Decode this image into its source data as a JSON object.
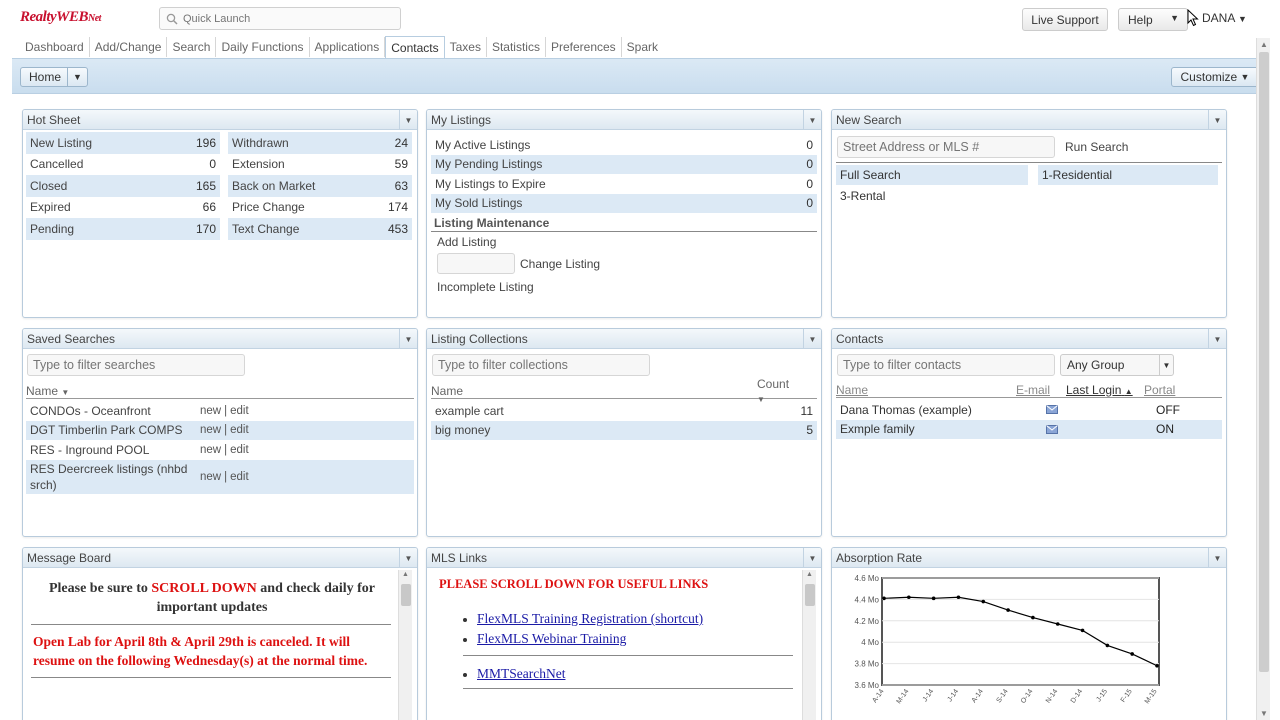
{
  "app": {
    "logo_main": "RealtyWEB",
    "logo_net": "Net",
    "quick_launch_placeholder": "Quick Launch",
    "live_support": "Live Support",
    "help": "Help",
    "user": "DANA"
  },
  "tabs": [
    "Dashboard",
    "Add/Change",
    "Search",
    "Daily Functions",
    "Applications",
    "Contacts",
    "Taxes",
    "Statistics",
    "Preferences",
    "Spark"
  ],
  "active_tab": "Contacts",
  "band": {
    "home": "Home",
    "customize": "Customize"
  },
  "hot_sheet": {
    "title": "Hot Sheet",
    "left": [
      {
        "label": "New Listing",
        "count": "196"
      },
      {
        "label": "Cancelled",
        "count": "0"
      },
      {
        "label": "Closed",
        "count": "165"
      },
      {
        "label": "Expired",
        "count": "66"
      },
      {
        "label": "Pending",
        "count": "170"
      }
    ],
    "right": [
      {
        "label": "Withdrawn",
        "count": "24"
      },
      {
        "label": "Extension",
        "count": "59"
      },
      {
        "label": "Back on Market",
        "count": "63"
      },
      {
        "label": "Price Change",
        "count": "174"
      },
      {
        "label": "Text Change",
        "count": "453"
      }
    ]
  },
  "my_listings": {
    "title": "My Listings",
    "items": [
      {
        "label": "My Active Listings",
        "count": "0"
      },
      {
        "label": "My Pending Listings",
        "count": "0"
      },
      {
        "label": "My Listings to Expire",
        "count": "0"
      },
      {
        "label": "My Sold Listings",
        "count": "0"
      }
    ],
    "maintenance_title": "Listing Maintenance",
    "add_listing": "Add Listing",
    "change_listing": "Change Listing",
    "incomplete_listing": "Incomplete Listing"
  },
  "new_search": {
    "title": "New Search",
    "placeholder": "Street Address or MLS #",
    "run": "Run Search",
    "options": [
      "Full Search",
      "3-Rental",
      "1-Residential"
    ]
  },
  "saved_searches": {
    "title": "Saved Searches",
    "placeholder": "Type to filter searches",
    "col_name": "Name",
    "rows": [
      {
        "name": "CONDOs - Oceanfront",
        "new": "new",
        "sep": "|",
        "edit": "edit"
      },
      {
        "name": "DGT Timberlin Park COMPS",
        "new": "new",
        "sep": "|",
        "edit": "edit"
      },
      {
        "name": "RES - Inground POOL",
        "new": "new",
        "sep": "|",
        "edit": "edit"
      },
      {
        "name": "RES Deercreek listings (nhbd srch)",
        "new": "new",
        "sep": "|",
        "edit": "edit"
      }
    ]
  },
  "collections": {
    "title": "Listing Collections",
    "placeholder": "Type to filter collections",
    "col_name": "Name",
    "col_count": "Count",
    "rows": [
      {
        "name": "example cart",
        "count": "11"
      },
      {
        "name": "big money",
        "count": "5"
      }
    ]
  },
  "contacts": {
    "title": "Contacts",
    "placeholder": "Type to filter contacts",
    "group": "Any Group",
    "col_name": "Name",
    "col_email": "E-mail",
    "col_login": "Last Login",
    "col_portal": "Portal",
    "rows": [
      {
        "name": "Dana Thomas (example)",
        "portal": "OFF"
      },
      {
        "name": "Exmple family",
        "portal": "ON"
      }
    ]
  },
  "message_board": {
    "title": "Message Board",
    "p1_a": "Please be sure to",
    "p1_b": "SCROLL DOWN",
    "p1_c": "and check daily for important updates",
    "p2": "Open Lab for April 8th & April 29th is canceled.  It will resume on the following Wednesday(s) at the normal time."
  },
  "mls_links": {
    "title": "MLS Links",
    "header": "PLEASE SCROLL DOWN FOR USEFUL LINKS",
    "links": [
      "FlexMLS Training Registration (shortcut)",
      "FlexMLS Webinar Training"
    ],
    "link3": "MMTSearchNet"
  },
  "absorption": {
    "title": "Absorption Rate"
  },
  "chart_data": {
    "type": "line",
    "categories": [
      "A-14",
      "M-14",
      "J-14",
      "J-14",
      "A-14",
      "S-14",
      "O-14",
      "N-14",
      "D-14",
      "J-15",
      "F-15",
      "M-15"
    ],
    "values": [
      4.41,
      4.42,
      4.41,
      4.42,
      4.38,
      4.3,
      4.23,
      4.17,
      4.11,
      3.97,
      3.89,
      3.78
    ],
    "yticks": [
      "4.6 Mo",
      "4.4 Mo",
      "4.2 Mo",
      "4 Mo",
      "3.8 Mo",
      "3.6 Mo"
    ],
    "ylim": [
      3.6,
      4.6
    ],
    "line_color": "#000000"
  }
}
